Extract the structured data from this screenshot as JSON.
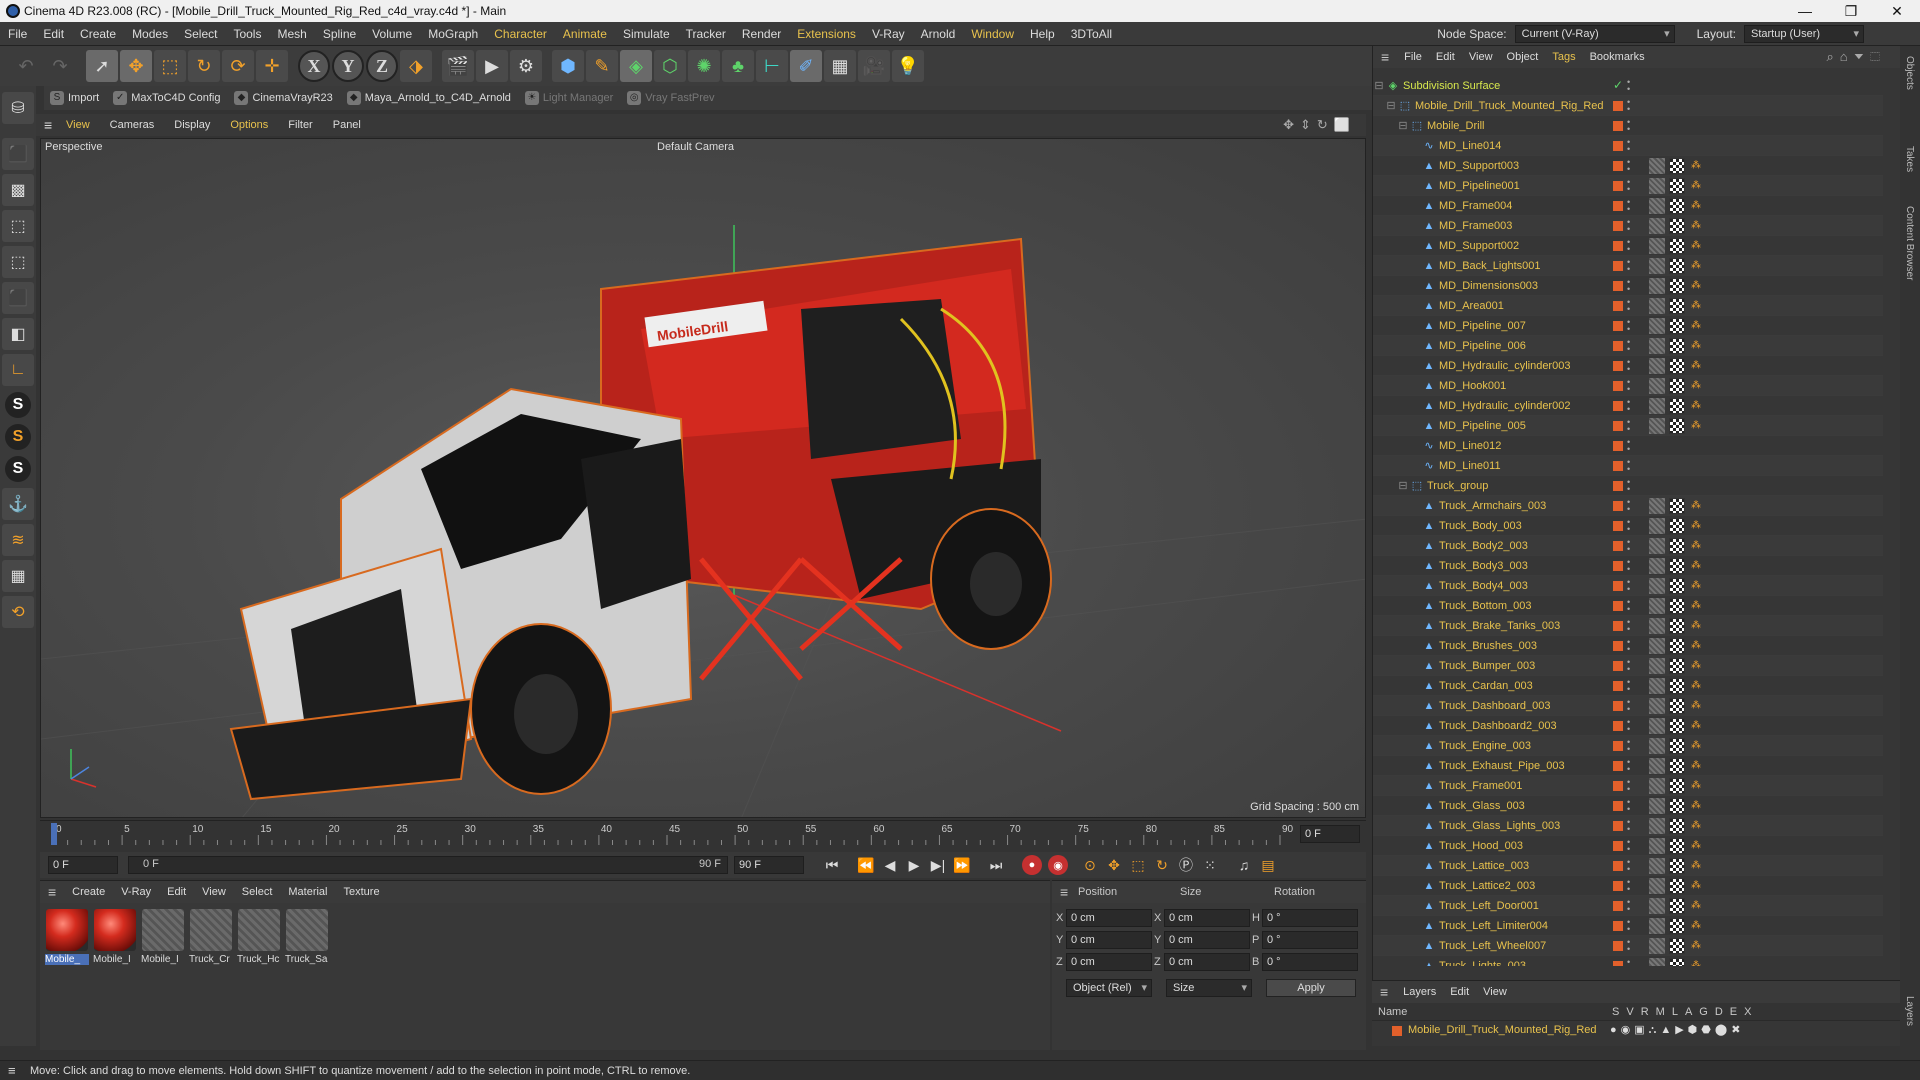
{
  "window": {
    "title": "Cinema 4D R23.008 (RC) - [Mobile_Drill_Truck_Mounted_Rig_Red_c4d_vray.c4d *] - Main",
    "controls": [
      "—",
      "❐",
      "✕"
    ]
  },
  "menubar": {
    "items": [
      "File",
      "Edit",
      "Create",
      "Modes",
      "Select",
      "Tools",
      "Mesh",
      "Spline",
      "Volume",
      "MoGraph",
      "Character",
      "Animate",
      "Simulate",
      "Tracker",
      "Render",
      "Extensions",
      "V-Ray",
      "Arnold",
      "Window",
      "Help",
      "3DToAll"
    ],
    "node_space_label": "Node Space:",
    "node_space_value": "Current (V-Ray)",
    "layout_label": "Layout:",
    "layout_value": "Startup (User)"
  },
  "plugins": [
    {
      "label": "Import",
      "enabled": true
    },
    {
      "label": "MaxToC4D Config",
      "enabled": true
    },
    {
      "label": "CinemaVrayR23",
      "enabled": true
    },
    {
      "label": "Maya_Arnold_to_C4D_Arnold",
      "enabled": true
    },
    {
      "label": "Light Manager",
      "enabled": false
    },
    {
      "label": "Vray FastPrev",
      "enabled": false
    }
  ],
  "viewport": {
    "menu": [
      "View",
      "Cameras",
      "Display",
      "Options",
      "Filter",
      "Panel"
    ],
    "name": "Perspective",
    "camera": "Default Camera",
    "grid_spacing": "Grid Spacing : 500 cm",
    "truck_logo": "MobileDrill"
  },
  "timeline": {
    "ticks": [
      "0",
      "5",
      "10",
      "15",
      "20",
      "25",
      "30",
      "35",
      "40",
      "45",
      "50",
      "55",
      "60",
      "65",
      "70",
      "75",
      "80",
      "85",
      "90"
    ],
    "current_frame": "0 F",
    "start": "0 F",
    "range_start": "0 F",
    "range_end": "90 F",
    "end": "90 F"
  },
  "material_manager": {
    "menu": [
      "Create",
      "V-Ray",
      "Edit",
      "View",
      "Select",
      "Material",
      "Texture"
    ],
    "materials": [
      {
        "label": "Mobile_",
        "style": "red"
      },
      {
        "label": "Mobile_I",
        "style": "red"
      },
      {
        "label": "Mobile_I",
        "style": "gr"
      },
      {
        "label": "Truck_Cr",
        "style": "gr"
      },
      {
        "label": "Truck_Hc",
        "style": "gr"
      },
      {
        "label": "Truck_Sa",
        "style": "gr"
      }
    ]
  },
  "attributes": {
    "headers": [
      "Position",
      "Size",
      "Rotation"
    ],
    "rows": [
      {
        "axis": "X",
        "pos": "0 cm",
        "saxis": "X",
        "size": "0 cm",
        "raxis": "H",
        "rot": "0 °"
      },
      {
        "axis": "Y",
        "pos": "0 cm",
        "saxis": "Y",
        "size": "0 cm",
        "raxis": "P",
        "rot": "0 °"
      },
      {
        "axis": "Z",
        "pos": "0 cm",
        "saxis": "Z",
        "size": "0 cm",
        "raxis": "B",
        "rot": "0 °"
      }
    ],
    "mode": "Object (Rel)",
    "size_mode": "Size",
    "apply": "Apply"
  },
  "object_manager": {
    "menu": [
      "File",
      "Edit",
      "View",
      "Object",
      "Tags",
      "Bookmarks"
    ],
    "objects": [
      {
        "name": "Subdivision Surface",
        "indent": 0,
        "kind": "root"
      },
      {
        "name": "Mobile_Drill_Truck_Mounted_Rig_Red",
        "indent": 1,
        "kind": "null"
      },
      {
        "name": "Mobile_Drill",
        "indent": 2,
        "kind": "null"
      },
      {
        "name": "MD_Line014",
        "indent": 3,
        "kind": "spline"
      },
      {
        "name": "MD_Support003",
        "indent": 3,
        "kind": "mesh"
      },
      {
        "name": "MD_Pipeline001",
        "indent": 3,
        "kind": "mesh"
      },
      {
        "name": "MD_Frame004",
        "indent": 3,
        "kind": "mesh"
      },
      {
        "name": "MD_Frame003",
        "indent": 3,
        "kind": "mesh"
      },
      {
        "name": "MD_Support002",
        "indent": 3,
        "kind": "mesh"
      },
      {
        "name": "MD_Back_Lights001",
        "indent": 3,
        "kind": "mesh"
      },
      {
        "name": "MD_Dimensions003",
        "indent": 3,
        "kind": "mesh"
      },
      {
        "name": "MD_Area001",
        "indent": 3,
        "kind": "mesh"
      },
      {
        "name": "MD_Pipeline_007",
        "indent": 3,
        "kind": "mesh"
      },
      {
        "name": "MD_Pipeline_006",
        "indent": 3,
        "kind": "mesh"
      },
      {
        "name": "MD_Hydraulic_cylinder003",
        "indent": 3,
        "kind": "mesh"
      },
      {
        "name": "MD_Hook001",
        "indent": 3,
        "kind": "mesh"
      },
      {
        "name": "MD_Hydraulic_cylinder002",
        "indent": 3,
        "kind": "mesh"
      },
      {
        "name": "MD_Pipeline_005",
        "indent": 3,
        "kind": "mesh"
      },
      {
        "name": "MD_Line012",
        "indent": 3,
        "kind": "spline"
      },
      {
        "name": "MD_Line011",
        "indent": 3,
        "kind": "spline"
      },
      {
        "name": "Truck_group",
        "indent": 2,
        "kind": "null"
      },
      {
        "name": "Truck_Armchairs_003",
        "indent": 3,
        "kind": "mesh"
      },
      {
        "name": "Truck_Body_003",
        "indent": 3,
        "kind": "mesh"
      },
      {
        "name": "Truck_Body2_003",
        "indent": 3,
        "kind": "mesh"
      },
      {
        "name": "Truck_Body3_003",
        "indent": 3,
        "kind": "mesh"
      },
      {
        "name": "Truck_Body4_003",
        "indent": 3,
        "kind": "mesh"
      },
      {
        "name": "Truck_Bottom_003",
        "indent": 3,
        "kind": "mesh"
      },
      {
        "name": "Truck_Brake_Tanks_003",
        "indent": 3,
        "kind": "mesh"
      },
      {
        "name": "Truck_Brushes_003",
        "indent": 3,
        "kind": "mesh"
      },
      {
        "name": "Truck_Bumper_003",
        "indent": 3,
        "kind": "mesh"
      },
      {
        "name": "Truck_Cardan_003",
        "indent": 3,
        "kind": "mesh"
      },
      {
        "name": "Truck_Dashboard_003",
        "indent": 3,
        "kind": "mesh"
      },
      {
        "name": "Truck_Dashboard2_003",
        "indent": 3,
        "kind": "mesh"
      },
      {
        "name": "Truck_Engine_003",
        "indent": 3,
        "kind": "mesh"
      },
      {
        "name": "Truck_Exhaust_Pipe_003",
        "indent": 3,
        "kind": "mesh"
      },
      {
        "name": "Truck_Frame001",
        "indent": 3,
        "kind": "mesh"
      },
      {
        "name": "Truck_Glass_003",
        "indent": 3,
        "kind": "mesh"
      },
      {
        "name": "Truck_Glass_Lights_003",
        "indent": 3,
        "kind": "mesh"
      },
      {
        "name": "Truck_Hood_003",
        "indent": 3,
        "kind": "mesh"
      },
      {
        "name": "Truck_Lattice_003",
        "indent": 3,
        "kind": "mesh"
      },
      {
        "name": "Truck_Lattice2_003",
        "indent": 3,
        "kind": "mesh"
      },
      {
        "name": "Truck_Left_Door001",
        "indent": 3,
        "kind": "mesh"
      },
      {
        "name": "Truck_Left_Limiter004",
        "indent": 3,
        "kind": "mesh"
      },
      {
        "name": "Truck_Left_Wheel007",
        "indent": 3,
        "kind": "mesh"
      },
      {
        "name": "Truck_Lights_003",
        "indent": 3,
        "kind": "mesh"
      }
    ]
  },
  "layers": {
    "menu": [
      "Layers",
      "Edit",
      "View"
    ],
    "name_header": "Name",
    "flags": [
      "S",
      "V",
      "R",
      "M",
      "L",
      "A",
      "G",
      "D",
      "E",
      "X"
    ],
    "layer_name": "Mobile_Drill_Truck_Mounted_Rig_Red"
  },
  "side_tabs": [
    "Objects",
    "Takes",
    "Content Browser",
    "Layers"
  ],
  "status": "Move: Click and drag to move elements. Hold down SHIFT to quantize movement / add to the selection in point mode, CTRL to remove.",
  "colors": {
    "accent": "#e8c24d",
    "orange": "#e2602b",
    "selection": "#4a70b8"
  }
}
